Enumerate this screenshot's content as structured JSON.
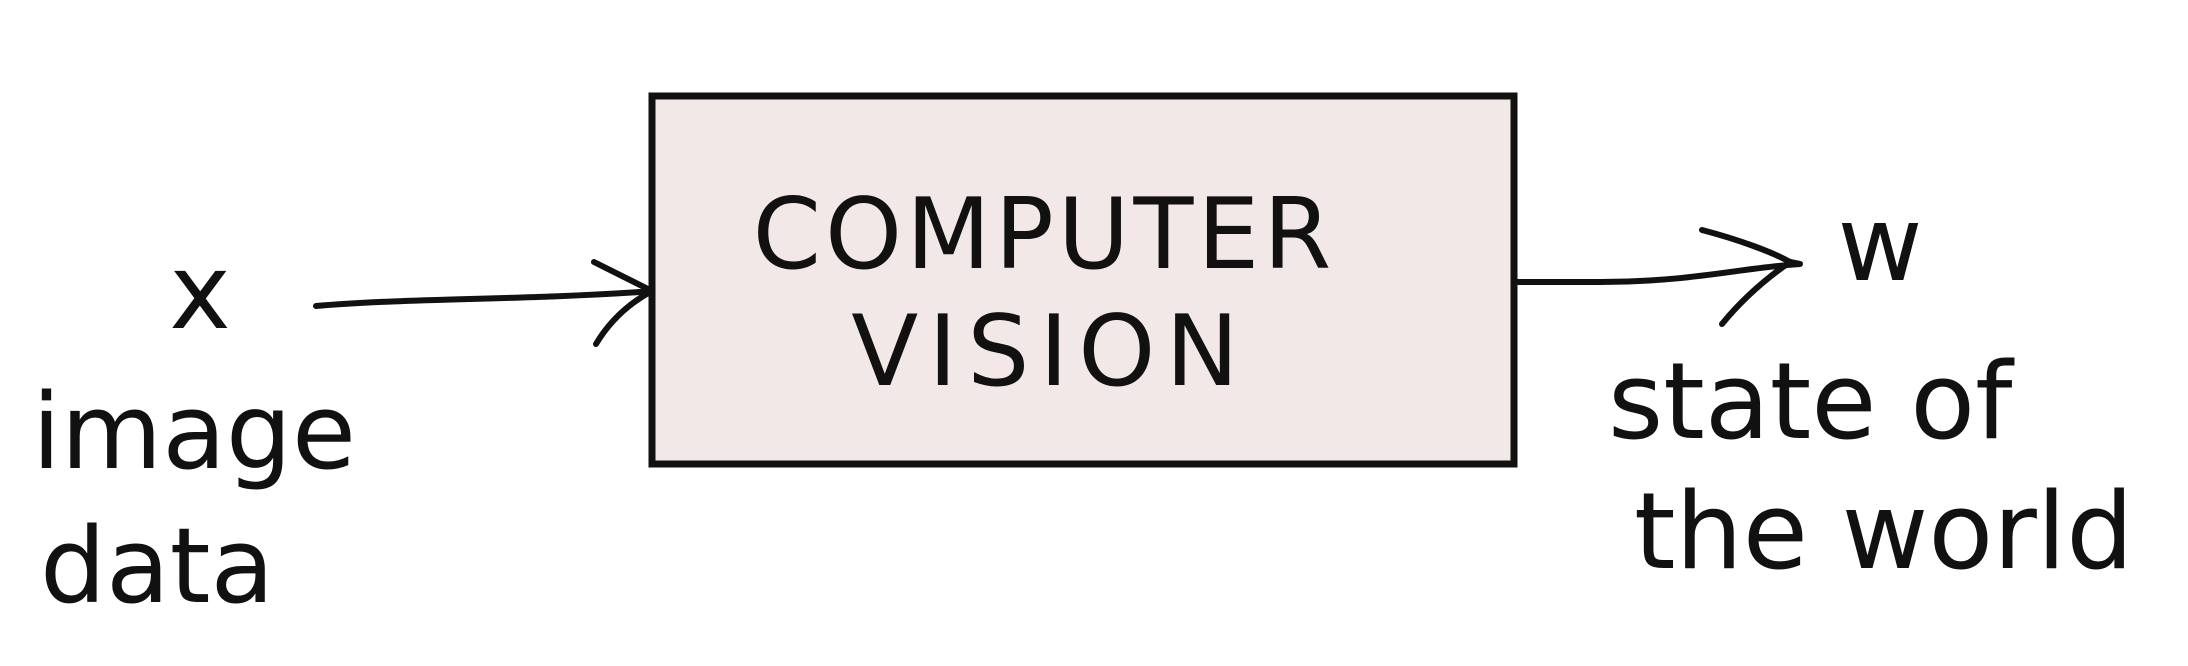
{
  "diagram": {
    "box": {
      "line1": "COMPUTER",
      "line2": "VISION",
      "fill_color": "#f3e8e8",
      "border_color": "#111111"
    },
    "input": {
      "symbol": "x",
      "label_line1": "image",
      "label_line2": "data"
    },
    "output": {
      "symbol": "w",
      "label_line1": "state of",
      "label_line2": "the world"
    }
  }
}
